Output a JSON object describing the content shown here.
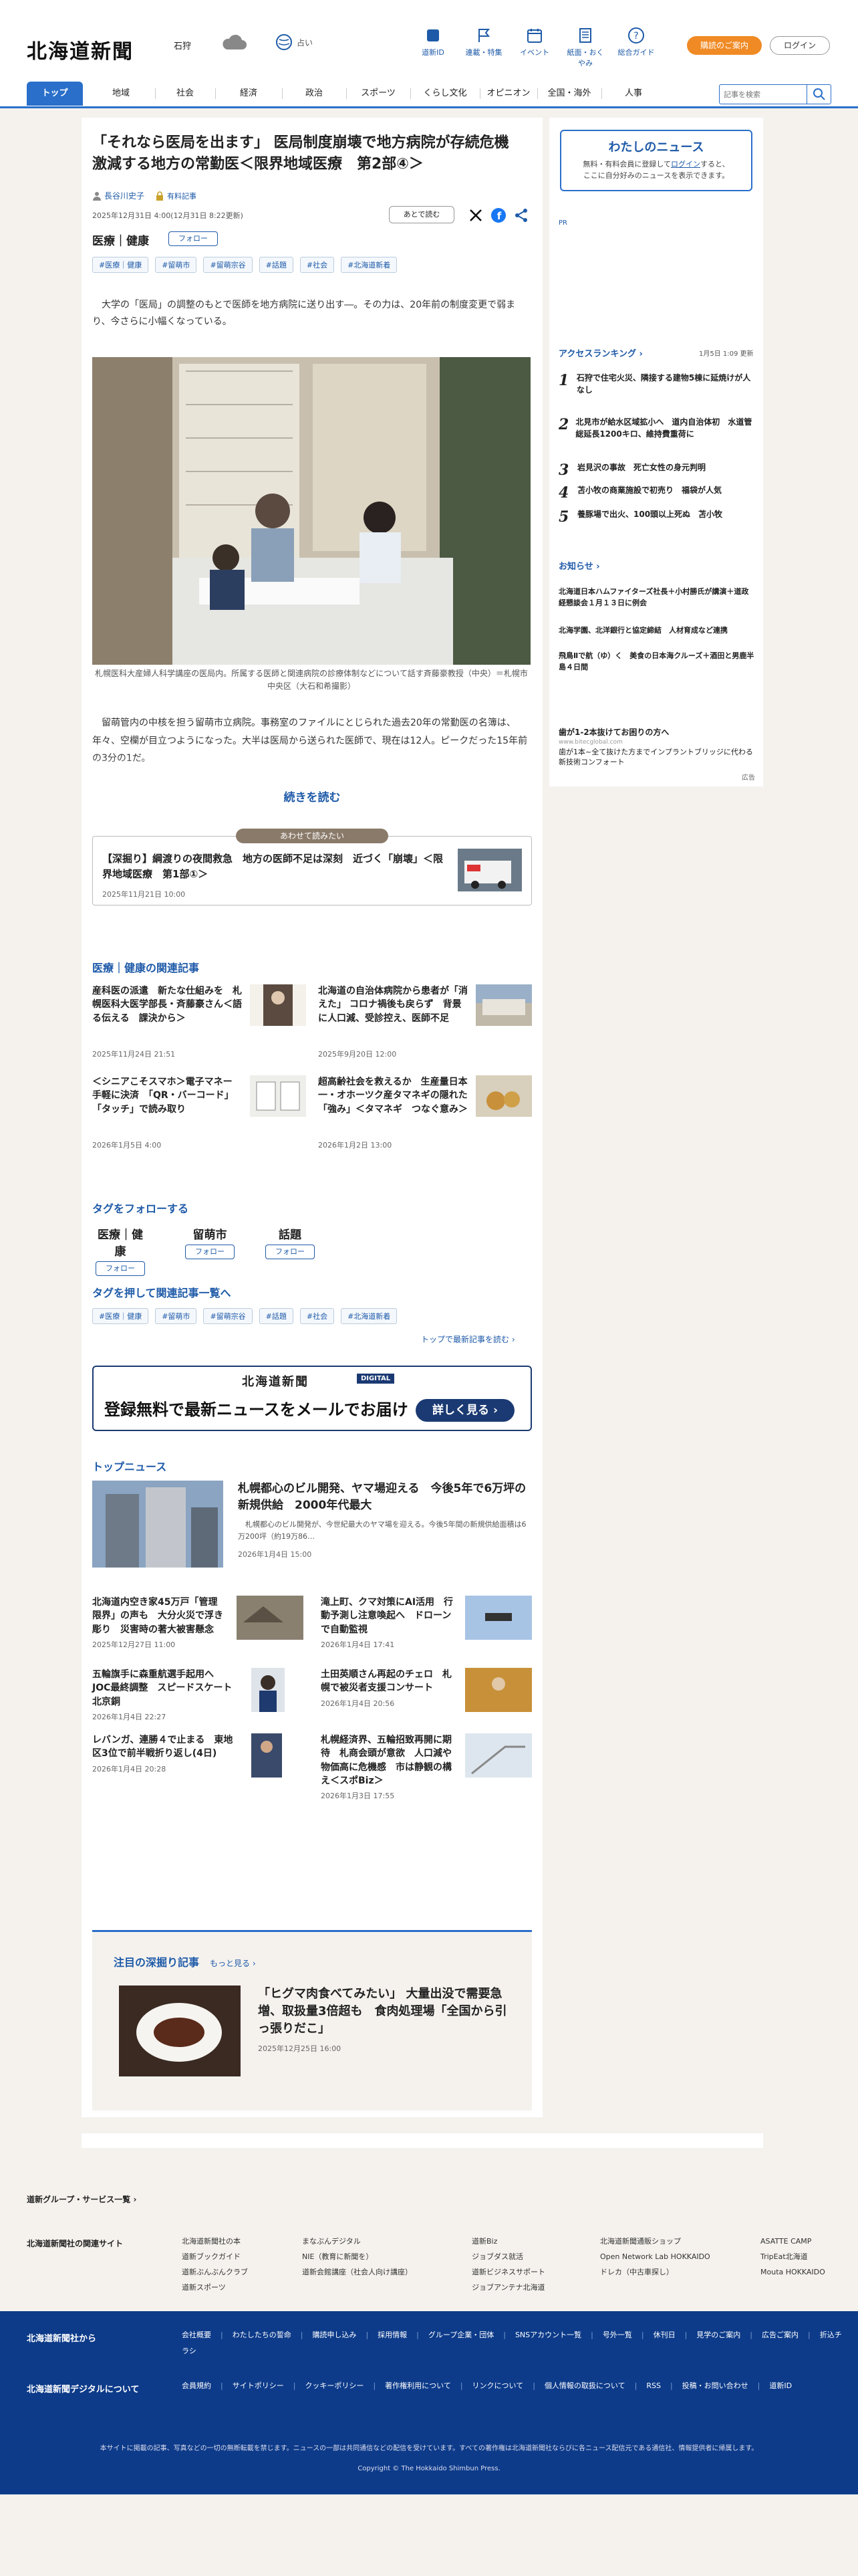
{
  "header": {
    "logo": "北海道新聞",
    "region": "石狩",
    "weather2": "占い",
    "nav": [
      "道新ID",
      "連載・特集",
      "イベント",
      "紙面・おくやみ",
      "総合ガイド"
    ],
    "subscribe": "購読のご案内",
    "login": "ログイン",
    "tabs": [
      "トップ",
      "地域",
      "社会",
      "経済",
      "政治",
      "スポーツ",
      "くらし文化",
      "オピニオン",
      "全国・海外",
      "人事"
    ],
    "search_placeholder": "記事を検索"
  },
  "article": {
    "title": "「それなら医局を出ます」 医局制度崩壊で地方病院が存続危機　激減する地方の常勤医＜限界地域医療　第2部④＞",
    "author": "長谷川史子",
    "paid": "有料記事",
    "date": "2025年12月31日 4:00(12月31日 8:22更新)",
    "save": "あとで読む",
    "category": "医療｜健康",
    "follow": "フォロー",
    "tags": [
      "#医療｜健康",
      "#留萌市",
      "#留萌宗谷",
      "#話題",
      "#社会",
      "#北海道新着"
    ],
    "lead": "　大学の「医局」の調整のもとで医師を地方病院に送り出す―。その力は、20年前の制度変更で弱まり、今さらに小幅くなっている。",
    "caption": "札幌医科大産婦人科学講座の医局内。所属する医師と関連病院の診療体制などについて話す斉藤豪教授（中央）＝札幌市中央区（大石和希撮影）",
    "body": "　留萌管内の中核を担う留萌市立病院。事務室のファイルにとじられた過去20年の常勤医の名簿は、年々、空欄が目立つようになった。大半は医局から送られた医師で、現在は12人。ピークだった15年前の3分の1だ。",
    "more": "続きを読む",
    "related_label": "あわせて読みたい",
    "related_title": "【深掘り】綱渡りの夜間救急　地方の医師不足は深刻　近づく「崩壊」＜限界地域医療　第1部①＞",
    "related_date": "2025年11月21日 10:00"
  },
  "related": {
    "heading": "医療｜健康の関連記事",
    "items": [
      {
        "title": "産科医の派遣　新たな仕組みを　札幌医科大医学部長・斉藤豪さん＜語る伝える　課決から＞",
        "date": "2025年11月24日 21:51"
      },
      {
        "title": "北海道の自治体病院から患者が「消えた」 コロナ禍後も戻らず　背景に人口減、受診控え、医師不足",
        "date": "2025年9月20日 12:00"
      },
      {
        "title": "＜シニアこそスマホ＞電子マネー　手軽に決済　「QR・バーコード」「タッチ」で読み取り",
        "date": "2026年1月5日 4:00"
      },
      {
        "title": "超高齢社会を救えるか　生産量日本一・オホーツク産タマネギの隠れた「強み」＜タマネギ　つなぐ意み＞",
        "date": "2026年1月2日 13:00"
      }
    ]
  },
  "follow_tags": {
    "heading": "タグをフォローする",
    "items": [
      "医療｜健康",
      "留萌市",
      "話題"
    ],
    "label": "フォロー"
  },
  "push_tags": {
    "heading": "タグを押して関連記事一覧へ",
    "items": [
      "#医療｜健康",
      "#留萌市",
      "#留萌宗谷",
      "#話題",
      "#社会",
      "#北海道新着"
    ],
    "readmore": "トップで最新記事を読む"
  },
  "promo": {
    "logo": "北海道新聞",
    "digital": "DIGITAL",
    "text": "登録無料で最新ニュースをメールでお届け",
    "button": "詳しく見る"
  },
  "topnews": {
    "heading": "トップニュース",
    "main": {
      "title": "札幌都心のビル開発、ヤマ場迎える　今後5年で6万坪の新規供給　2000年代最大",
      "lead": "　札幌都心のビル開発が、今世紀最大のヤマ場を迎える。今後5年間の新規供給面積は6万200坪（約19万86…",
      "date": "2026年1月4日 15:00"
    },
    "items": [
      {
        "title": "北海道内空き家45万戸「管理限界」の声も　大分火災で浮き彫り　災害時の著大被害懸念",
        "date": "2025年12月27日 11:00"
      },
      {
        "title": "滝上町、クマ対策にAI活用　行動予測し注意喚起へ　ドローンで自動監視",
        "date": "2026年1月4日 17:41"
      },
      {
        "title": "五輪旗手に森重航選手起用へ　JOC最終調整　スピードスケート北京銅",
        "date": "2026年1月4日 22:27"
      },
      {
        "title": "土田英順さん再起のチェロ　札幌で被災者支援コンサート",
        "date": "2026年1月4日 20:56"
      },
      {
        "title": "レバンガ、連勝４で止まる　東地区3位で前半戦折り返し(4日)",
        "date": "2026年1月4日 20:28"
      },
      {
        "title": "札幌経済界、五輪招致再開に期待　札商会頭が意欲　人口減や物価高に危機感　市は静観の構え＜スポBiz＞",
        "date": "2026年1月3日 17:55"
      }
    ]
  },
  "attention": {
    "heading": "注目の深掘り記事",
    "more": "もっと見る",
    "title": "「ヒグマ肉食べてみたい」 大量出没で需要急増、取扱量3倍超も　食肉処理場「全国から引っ張りだこ」",
    "date": "2025年12月25日 16:00"
  },
  "sidebar": {
    "mynews_title": "わたしのニュース",
    "mynews_desc1": "無料・有料会員に登録して",
    "mynews_login": "ログイン",
    "mynews_desc2": "すると、",
    "mynews_desc3": "ここに自分好みのニュースを表示できます。",
    "ad_label": "PR",
    "ranking_heading": "アクセスランキング",
    "ranking_date": "1月5日 1:09 更新",
    "ranking": [
      "石狩で住宅火災、隣接する建物5棟に延焼けが人なし",
      "北見市が給水区域拡小へ　道内自治体初　水道管総延長1200キロ、維持費重荷に",
      "岩見沢の事故　死亡女性の身元判明",
      "苫小牧の商業施設で初売り　福袋が人気",
      "養豚場で出火、100頭以上死ぬ　苫小牧"
    ],
    "notice_heading": "お知らせ",
    "notices": [
      "北海道日本ハムファイターズ社長＋小村勝氏が講演＋道政経懇談会１月１３日に例会",
      "北海学園、北洋銀行と協定締結　人材育成など連携",
      "飛鳥Ⅱで航（ゆ）く　美食の日本海クルーズ＋酒田と男鹿半島４日間"
    ],
    "ad_title": "歯が1-2本抜けてお困りの方へ",
    "ad_url": "www.bitecglobal.com",
    "ad_desc": "歯が1本~全て抜けた方までインプラントブリッジに代わる新技術コンフォート",
    "ad_mark": "広告"
  },
  "footer_top": {
    "group": "道新グループ・サービス一覧",
    "related_sites": "北海道新聞社の関連サイト",
    "sites": [
      [
        "北海道新聞社の本",
        "道新ブックガイド",
        "道新ぶんぶんクラブ",
        "道新スポーツ"
      ],
      [
        "まなぶんデジタル",
        "NIE（教育に新聞を）",
        "道新会館講座（社会人向け講座）"
      ],
      [
        "道新Biz",
        "ジョブダス就活",
        "道新ビジネスサポート",
        "ジョブアンテナ北海道"
      ],
      [
        "北海道新聞通販ショップ",
        "Open Network Lab HOKKAIDO",
        "ドレカ（中古車探し）"
      ],
      [
        "ASATTE CAMP",
        "TripEat北海道",
        "Mouta HOKKAIDO"
      ]
    ]
  },
  "footer": {
    "h1": "北海道新聞社から",
    "links1": [
      "会社概要",
      "わたしたちの誓命",
      "購読申し込み",
      "採用情報",
      "グループ企業・団体",
      "SNSアカウント一覧",
      "号外一覧",
      "休刊日",
      "見学のご案内",
      "広告ご案内",
      "折込チラシ"
    ],
    "h2": "北海道新聞デジタルについて",
    "links2": [
      "会員規約",
      "サイトポリシー",
      "クッキーポリシー",
      "著作権利用について",
      "リンクについて",
      "個人情報の取扱について",
      "RSS",
      "投稿・お問い合わせ",
      "道新ID"
    ],
    "notice": "本サイトに掲載の記事、写真などの一切の無断転載を禁じます。ニュースの一部は共同通信などの配信を受けています。すべての著作権は北海道新聞社ならびに各ニュース配信元である通信社、情報提供者に帰属します。",
    "copyright": "Copyright © The Hokkaido Shimbun Press."
  }
}
